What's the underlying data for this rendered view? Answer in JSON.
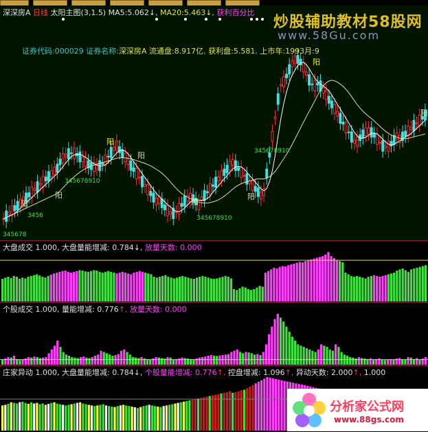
{
  "main_header": {
    "stock": "深深房",
    "stock_marker": "A",
    "period": "日线",
    "indicator": "太阳主图(3,1.5)",
    "ma5_label": "MA5:",
    "ma5_value": "5.062",
    "ma5_arrow": "↓",
    "ma20_label": "MA20:",
    "ma20_value": "5.463",
    "ma20_arrow": "↓",
    "extra": "获利百分比"
  },
  "info_line": {
    "code_label": "证券代码:",
    "code_value": "000029",
    "name_label": "证券名称:",
    "name_value": "深深房",
    "name_marker": "A",
    "float_label": "流通盘:",
    "float_value": "8.917亿",
    "profit_label": "获利盘:",
    "profit_value": "5.581",
    "list_label": "上市年:",
    "list_value": "1993月:9"
  },
  "watermark": {
    "title": "炒股辅助教材58股网",
    "url": "www.58Gu.com"
  },
  "panel2_header": {
    "name": "大盘成交",
    "v1": "1.000,",
    "label2": "大盘量能增减:",
    "v2": "0.784",
    "arrow2": "↓,",
    "label3": "放量天数:",
    "v3": "0.000"
  },
  "panel3_header": {
    "name": "个股成交",
    "v1": "1.000,",
    "label2": "量能增减:",
    "v2": "0.776",
    "arrow2": "↑,",
    "label3": "放量天数:",
    "v3": "0.000"
  },
  "panel4_header": {
    "name": "庄家异动",
    "v1": "1.000,",
    "label2": "大盘量能增减:",
    "v2": "0.784",
    "arrow2": "↓,",
    "label3": "个股量能增减:",
    "v3": "0.776",
    "arrow3": "↑,",
    "label4": "控盘增减:",
    "v4": "1.096",
    "arrow4": "↑,",
    "label5": "异动天数:",
    "v5": "2.000",
    "arrow5": "↑,",
    "v6": "1.000"
  },
  "chart_labels": {
    "yang": "阳",
    "seq": "345678910",
    "seq_short": "3456",
    "seq_bottom": "345678"
  },
  "logo": {
    "title": "分析家公式网",
    "url": "www.88gs.com"
  },
  "colors": {
    "up": "#ff3030",
    "down": "#40e0e0",
    "ma5": "#ffffff",
    "ma20": "#e0e0a0",
    "vol_up": "#ff40ff",
    "vol_down": "#40e040",
    "ref": "#e0e060"
  },
  "chart_data": [
    {
      "type": "candlestick",
      "title": "太阳主图(3,1.5)",
      "series": [
        {
          "name": "MA5",
          "last": 5.062
        },
        {
          "name": "MA20",
          "last": 5.463
        }
      ]
    },
    {
      "type": "bar",
      "title": "大盘成交",
      "values": [
        0.55,
        0.58,
        0.6,
        0.57,
        0.62,
        0.6,
        0.55,
        0.58,
        0.56,
        0.6,
        0.62,
        0.64,
        0.66,
        0.63,
        0.6,
        0.58,
        0.62,
        0.65,
        0.68,
        0.7,
        0.72,
        0.74,
        0.75,
        0.72,
        0.7,
        0.72,
        0.74,
        0.76,
        0.75,
        0.73,
        0.72,
        0.74,
        0.76,
        0.75,
        0.72,
        0.7,
        0.72,
        0.74,
        0.72,
        0.7,
        0.68,
        0.7,
        0.72,
        0.7,
        0.68,
        0.66,
        0.7,
        0.72,
        0.74,
        0.72,
        0.7,
        0.68,
        0.66,
        0.6,
        0.58,
        0.6,
        0.62,
        0.64,
        0.6,
        0.58,
        0.56,
        0.58,
        0.6,
        0.62,
        0.6,
        0.58,
        0.56,
        0.55,
        0.58,
        0.6,
        0.62,
        0.6,
        0.58,
        0.56,
        0.55,
        0.56,
        0.58,
        0.6,
        0.62,
        0.6,
        0.56,
        0.3,
        0.28,
        0.32,
        0.36,
        0.34,
        0.3,
        0.28,
        0.3,
        0.34,
        0.38,
        0.36,
        0.7,
        0.74,
        0.78,
        0.82,
        0.8,
        0.84,
        0.86,
        0.85,
        0.88,
        0.9,
        0.92,
        0.94,
        0.96,
        0.95,
        0.98,
        1.0,
        1.02,
        1.04,
        1.06,
        1.08,
        1.1,
        1.14,
        1.2,
        1.1,
        1.05,
        1.0,
        0.98,
        0.95,
        0.7,
        0.66,
        0.62,
        0.6,
        0.62,
        0.6,
        0.58,
        0.56,
        0.6,
        0.62,
        0.64,
        0.62,
        0.6,
        0.62,
        0.64,
        0.66,
        0.68,
        0.7,
        0.75,
        0.78,
        0.8,
        0.76,
        0.72,
        0.78,
        0.8,
        0.82,
        0.84,
        0.86,
        0.88
      ],
      "reference": 1.0
    },
    {
      "type": "bar",
      "title": "个股成交",
      "values": [
        0.2,
        0.25,
        0.3,
        0.28,
        0.35,
        0.22,
        0.18,
        0.2,
        0.25,
        0.3,
        0.28,
        0.32,
        0.3,
        0.26,
        0.28,
        0.3,
        0.45,
        0.6,
        0.75,
        0.95,
        0.7,
        0.5,
        0.4,
        0.35,
        0.3,
        0.28,
        0.26,
        0.3,
        0.32,
        0.28,
        0.26,
        0.3,
        0.35,
        0.4,
        0.55,
        0.5,
        0.45,
        0.4,
        0.35,
        0.38,
        0.42,
        0.55,
        0.6,
        0.5,
        0.4,
        0.3,
        0.28,
        0.26,
        0.3,
        0.25,
        0.22,
        0.2,
        0.25,
        0.3,
        0.28,
        0.26,
        0.24,
        0.3,
        0.28,
        0.2,
        0.22,
        0.25,
        0.28,
        0.26,
        0.24,
        0.22,
        0.2,
        0.25,
        0.28,
        0.3,
        0.32,
        0.35,
        0.38,
        0.36,
        0.34,
        0.36,
        0.38,
        0.4,
        0.42,
        0.5,
        0.55,
        0.6,
        0.5,
        0.45,
        0.5,
        0.48,
        0.45,
        0.4,
        0.42,
        0.38,
        0.5,
        0.8,
        1.2,
        1.5,
        1.8,
        2.0,
        1.85,
        1.7,
        1.5,
        1.3,
        1.1,
        0.95,
        0.8,
        0.75,
        0.7,
        0.65,
        0.6,
        0.55,
        0.5,
        0.6,
        0.8,
        0.75,
        0.7,
        0.6,
        0.55,
        0.8,
        0.7,
        0.5,
        0.4,
        0.35,
        0.3,
        0.28,
        0.25,
        0.3,
        0.26,
        0.24,
        0.22,
        0.25,
        0.2,
        0.22,
        0.25,
        0.2,
        0.18,
        0.2,
        0.22,
        0.2,
        0.24,
        0.26,
        0.22,
        0.2,
        0.3,
        0.28,
        0.22,
        0.26,
        0.2,
        0.24,
        0.3
      ],
      "reference": 0.2
    },
    {
      "type": "bar",
      "title": "庄家异动",
      "values": [
        0.8,
        0.82,
        0.85,
        0.9,
        0.88,
        0.86,
        0.9,
        0.92,
        0.88,
        0.85,
        0.9,
        0.86,
        0.88,
        0.84,
        0.86,
        0.82,
        0.85,
        0.88,
        0.9,
        0.86,
        0.84,
        0.82,
        0.8,
        0.82,
        0.84,
        0.86,
        0.88,
        0.9,
        0.86,
        0.84,
        0.82,
        0.8,
        0.78,
        0.8,
        0.82,
        0.84,
        0.8,
        0.78,
        0.76,
        0.75,
        0.78,
        0.8,
        0.82,
        0.8,
        0.78,
        0.76,
        0.74,
        0.72,
        0.75,
        0.78,
        0.8,
        0.82,
        0.8,
        0.78,
        0.76,
        0.75,
        0.78,
        0.8,
        0.82,
        0.84,
        0.86,
        0.88,
        0.9,
        0.92,
        0.94,
        0.96,
        0.98,
        1.0,
        1.02,
        1.04,
        1.06,
        1.08,
        1.1,
        1.12,
        1.14,
        1.16,
        1.18,
        1.2,
        1.22,
        1.25,
        1.2,
        1.22,
        1.25,
        1.28,
        1.3,
        1.35,
        1.4,
        1.45,
        1.5,
        1.55,
        1.6,
        1.65,
        1.7,
        1.68,
        1.66,
        1.64,
        1.62,
        1.6,
        1.58,
        1.56,
        1.54,
        1.52,
        1.5,
        1.48,
        1.46,
        1.44,
        1.42,
        1.4,
        1.38,
        1.36,
        1.34,
        1.32,
        1.3,
        1.28,
        1.25,
        1.2,
        1.18,
        1.15,
        1.12,
        1.1,
        1.08,
        1.05,
        1.0,
        0.98,
        0.95,
        0.92,
        0.9,
        0.88,
        0.86,
        0.84,
        0.82,
        0.8,
        0.78,
        0.76,
        0.74,
        0.72,
        0.7,
        0.68,
        0.66,
        0.64,
        0.62,
        0.6,
        0.58,
        0.56,
        0.54,
        0.52,
        0.5,
        0.48
      ],
      "reference": 1.0
    }
  ]
}
